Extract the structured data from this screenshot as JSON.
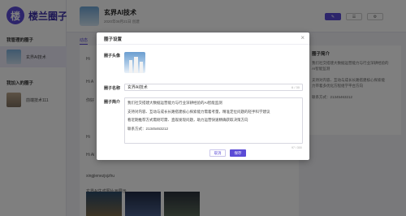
{
  "app": {
    "logo_mark": "楼",
    "logo_text": "楼兰圈子"
  },
  "sidebar": {
    "section_managed": "我管理的圈子",
    "managed_items": [
      {
        "label": "玄界AI技术"
      }
    ],
    "section_joined": "我加入的圈子",
    "joined_items": [
      {
        "label": "前端技术111"
      }
    ]
  },
  "header": {
    "title": "玄界AI技术",
    "subtitle": "2020年08月21日 创建",
    "buttons": [
      "",
      "",
      ""
    ]
  },
  "tab": {
    "label": "动态"
  },
  "feed": {
    "texts": [
      "Hi",
      "Hi A",
      "你好",
      "Hi",
      "Hi Ai",
      "玄界AI生成图片画展示"
    ],
    "author": "xingjienezjsjzhu"
  },
  "right_card": {
    "title": "圈子简介",
    "lines": [
      "我们社交搭建大数据运营能力与行业深耕经验的",
      "AI智能监测",
      "",
      "支持对内容、互动与成长长路搭建核心探索能",
      "力带着多优化方程组学平台方向",
      "",
      "联系方式：21345463212"
    ]
  },
  "modal": {
    "title": "圈子设置",
    "avatar_label": "圈子头像",
    "name_label": "圈子名称",
    "name_value": "玄界AI技术",
    "name_count": "6 / 30",
    "intro_label": "圈子简介",
    "intro_lines": [
      "我们社交搭建大数据运营能力与行业深耕经验的AI智能监测",
      "支持对内容、互动与成长长路搭建核心探索能力需着考量，精准定位问题的轻手科学建议",
      "看近期推荐方式需刚可需、直观发现问题，助力运营快速精确获取决策方向",
      "联系方式：21345463212"
    ],
    "intro_count": "97 / 300",
    "cancel_label": "取消",
    "save_label": "保存"
  },
  "colors": {
    "accent": "#5b4bd6",
    "overlay": "rgba(0,0,0,0.5)"
  }
}
